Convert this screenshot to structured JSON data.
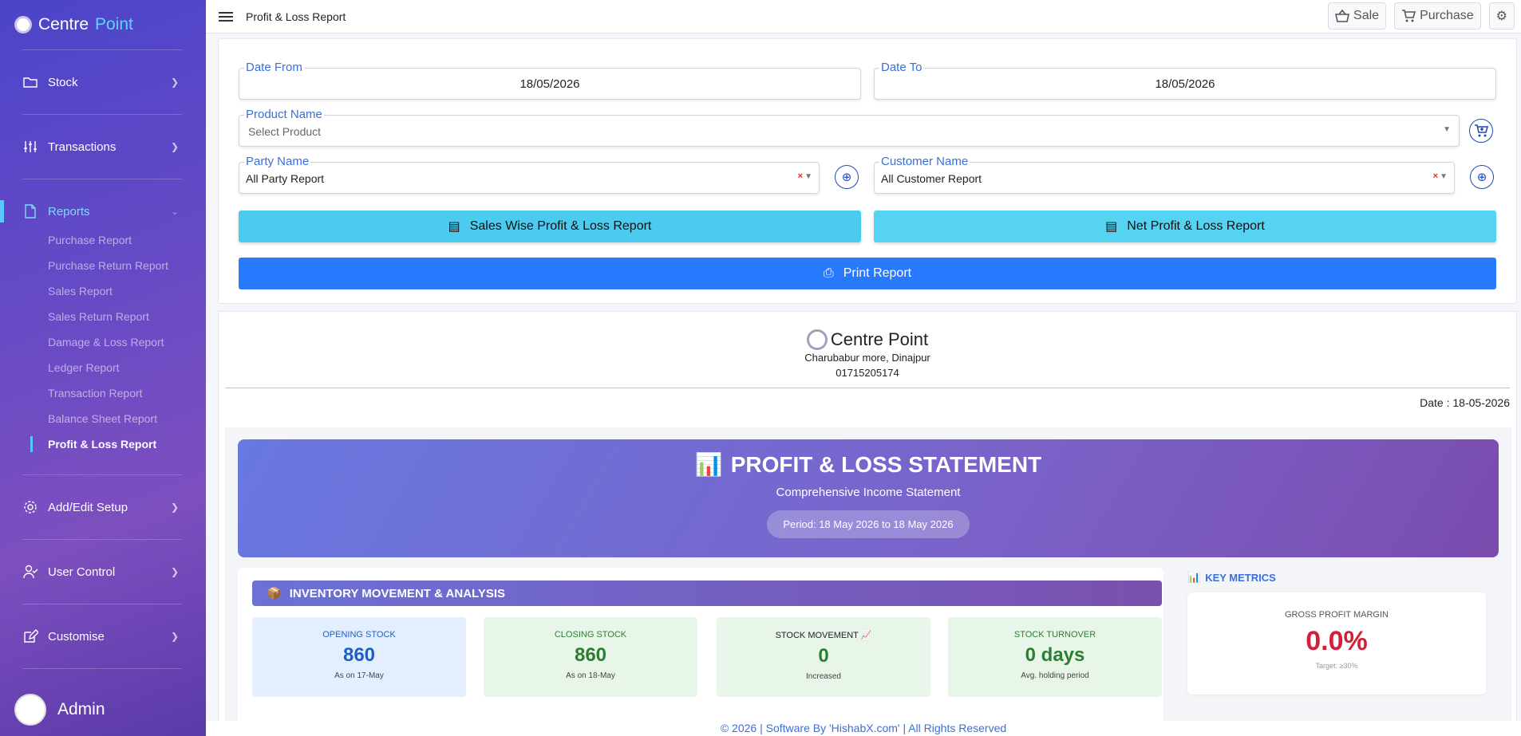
{
  "app": {
    "brand_a": "Centre",
    "brand_b": "Point",
    "user": "Admin"
  },
  "sidebar": {
    "items": [
      {
        "label": "Stock",
        "icon": "folder-icon"
      },
      {
        "label": "Transactions",
        "icon": "sliders-icon"
      },
      {
        "label": "Reports",
        "icon": "file-icon"
      },
      {
        "label": "Add/Edit Setup",
        "icon": "gear-icon"
      },
      {
        "label": "User Control",
        "icon": "user-check-icon"
      },
      {
        "label": "Customise",
        "icon": "edit-icon"
      }
    ],
    "reports": [
      "Purchase Report",
      "Purchase Return Report",
      "Sales Report",
      "Sales Return Report",
      "Damage & Loss Report",
      "Ledger Report",
      "Transaction Report",
      "Balance Sheet Report",
      "Profit & Loss Report"
    ]
  },
  "topbar": {
    "title": "Profit & Loss Report",
    "sale": "Sale",
    "purchase": "Purchase"
  },
  "filters": {
    "date_from_label": "Date From",
    "date_from": "18/05/2026",
    "date_to_label": "Date To",
    "date_to": "18/05/2026",
    "product_label": "Product Name",
    "product_placeholder": "Select Product",
    "party_label": "Party Name",
    "party_value": "All Party Report",
    "customer_label": "Customer Name",
    "customer_value": "All Customer Report",
    "sales_btn": "Sales Wise Profit & Loss Report",
    "net_btn": "Net Profit & Loss Report",
    "print_btn": "Print Report"
  },
  "report": {
    "company": "Centre Point",
    "address": "Charubabur more, Dinajpur",
    "phone": "01715205174",
    "date": "Date : 18-05-2026",
    "hero_title": "PROFIT & LOSS STATEMENT",
    "hero_sub": "Comprehensive Income Statement",
    "period": "Period: 18 May 2026 to 18 May 2026",
    "inv_title": "INVENTORY MOVEMENT & ANALYSIS",
    "cards": [
      {
        "title": "OPENING STOCK",
        "value": "860",
        "sub": "As on 17-May"
      },
      {
        "title": "CLOSING STOCK",
        "value": "860",
        "sub": "As on 18-May"
      },
      {
        "title": "STOCK MOVEMENT",
        "value": "0",
        "sub": "Increased"
      },
      {
        "title": "STOCK TURNOVER",
        "value": "0 days",
        "sub": "Avg. holding period"
      }
    ],
    "km_title": "KEY METRICS",
    "gpm_title": "GROSS PROFIT MARGIN",
    "gpm_value": "0.0%",
    "gpm_target": "Target: ≥30%"
  },
  "footer": "© 2026 | Software By 'HishabX.com' | All Rights Reserved",
  "colors": {
    "accent": "#2979ff",
    "cyan": "#4ccbf0",
    "danger": "#d1213a"
  }
}
